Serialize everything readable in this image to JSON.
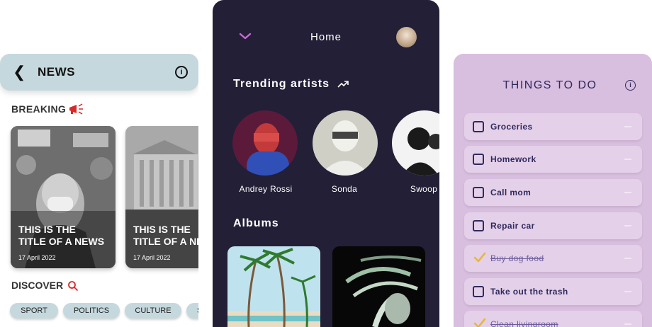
{
  "news": {
    "title": "NEWS",
    "breaking_label": "BREAKING",
    "cards": [
      {
        "title_line1": "THIS IS THE",
        "title_line2": "TITLE OF A NEWS",
        "date": "17 April 2022"
      },
      {
        "title_line1": "THIS IS THE",
        "title_line2": "TITLE OF A NEWS",
        "date": "17 April 2022"
      }
    ],
    "discover_label": "DISCOVER",
    "chips": [
      "SPORT",
      "POLITICS",
      "CULTURE",
      "S"
    ]
  },
  "music": {
    "title": "Home",
    "trending_label": "Trending artists",
    "artists": [
      {
        "name": "Andrey Rossi"
      },
      {
        "name": "Sonda"
      },
      {
        "name": "Swoop"
      }
    ],
    "albums_label": "Albums"
  },
  "todo": {
    "title": "THINGS TO DO",
    "items": [
      {
        "label": "Groceries",
        "done": false
      },
      {
        "label": "Homework",
        "done": false
      },
      {
        "label": "Call mom",
        "done": false
      },
      {
        "label": "Repair car",
        "done": false
      },
      {
        "label": "Buy dog food",
        "done": true
      },
      {
        "label": "Take out the trash",
        "done": false
      },
      {
        "label": "Clean livingroom",
        "done": true
      }
    ]
  },
  "colors": {
    "news_accent": "#c5d8dd",
    "music_bg": "#221f36",
    "todo_bg": "#d8bedf",
    "todo_text": "#2f2a5c",
    "breaking_red": "#d62a2a",
    "music_accent": "#c86bd6"
  }
}
